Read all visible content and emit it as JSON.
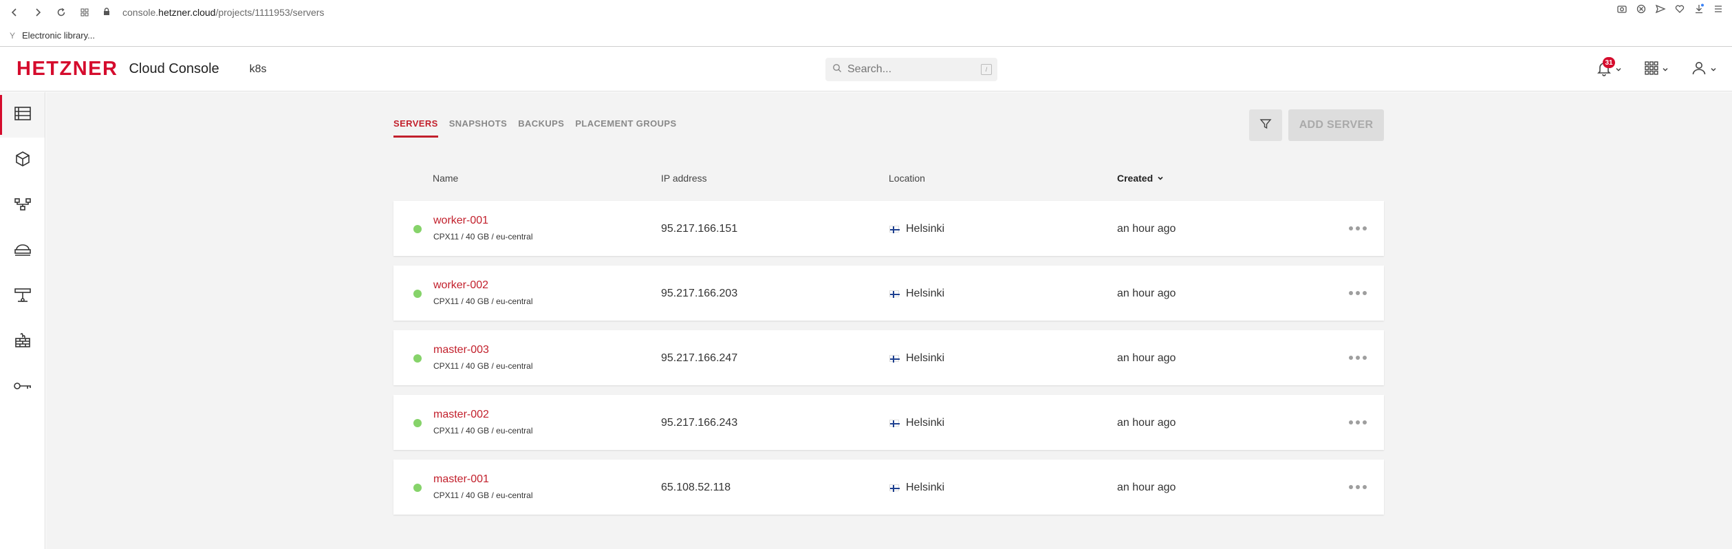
{
  "browser": {
    "url_prefix": "console.",
    "url_host": "hetzner.cloud",
    "url_path": "/projects/1111953/servers",
    "bookmark": "Electronic library..."
  },
  "header": {
    "logo": "HETZNER",
    "product": "Cloud Console",
    "project": "k8s",
    "search_placeholder": "Search...",
    "search_shortcut": "/",
    "notifications_count": "31"
  },
  "sidebar": {
    "items": [
      {
        "icon": "servers-icon",
        "active": true
      },
      {
        "icon": "volumes-icon",
        "active": false
      },
      {
        "icon": "networks-icon",
        "active": false
      },
      {
        "icon": "load-balancers-icon",
        "active": false
      },
      {
        "icon": "floating-ips-icon",
        "active": false
      },
      {
        "icon": "firewalls-icon",
        "active": false
      },
      {
        "icon": "ssh-keys-icon",
        "active": false
      }
    ]
  },
  "main": {
    "tabs": [
      "SERVERS",
      "SNAPSHOTS",
      "BACKUPS",
      "PLACEMENT GROUPS"
    ],
    "add_button": "ADD SERVER",
    "columns": {
      "name": "Name",
      "ip": "IP address",
      "location": "Location",
      "created": "Created"
    },
    "servers": [
      {
        "name": "worker-001",
        "spec": "CPX11 / 40 GB / eu-central",
        "ip": "95.217.166.151",
        "location": "Helsinki",
        "created": "an hour ago"
      },
      {
        "name": "worker-002",
        "spec": "CPX11 / 40 GB / eu-central",
        "ip": "95.217.166.203",
        "location": "Helsinki",
        "created": "an hour ago"
      },
      {
        "name": "master-003",
        "spec": "CPX11 / 40 GB / eu-central",
        "ip": "95.217.166.247",
        "location": "Helsinki",
        "created": "an hour ago"
      },
      {
        "name": "master-002",
        "spec": "CPX11 / 40 GB / eu-central",
        "ip": "95.217.166.243",
        "location": "Helsinki",
        "created": "an hour ago"
      },
      {
        "name": "master-001",
        "spec": "CPX11 / 40 GB / eu-central",
        "ip": "65.108.52.118",
        "location": "Helsinki",
        "created": "an hour ago"
      }
    ]
  },
  "colors": {
    "brand": "#d50c2d",
    "link": "#c2202c",
    "status_running": "#86d36a"
  }
}
